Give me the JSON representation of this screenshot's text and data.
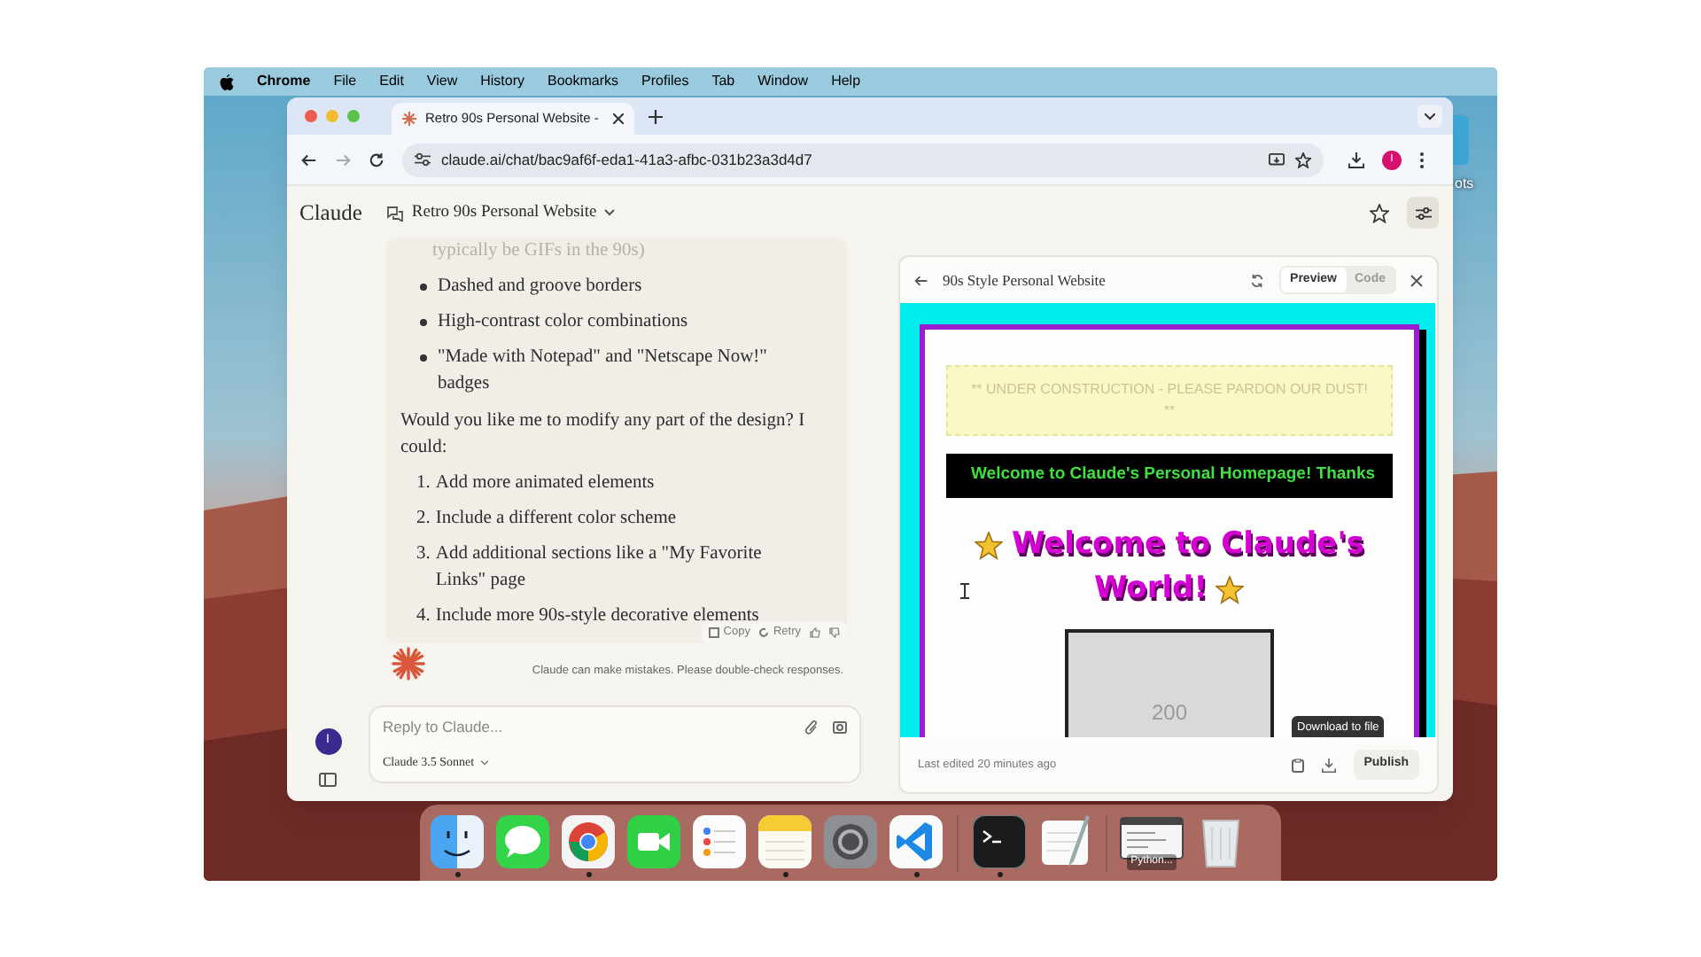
{
  "menu_bar": {
    "app": "Chrome",
    "items": [
      "File",
      "Edit",
      "View",
      "History",
      "Bookmarks",
      "Profiles",
      "Tab",
      "Window",
      "Help"
    ]
  },
  "desktop": {
    "label": "ots"
  },
  "browser": {
    "tabs": [
      {
        "title": "Retro 90s Personal Website -",
        "selected": true
      }
    ],
    "url": "claude.ai/chat/bac9af6f-eda1-41a3-afbc-031b23a3d4d7",
    "profile_initial": "I"
  },
  "claude": {
    "brand": "Claude",
    "chat_title": "Retro 90s Personal Website",
    "message": {
      "faded_line": "typically be GIFs in the 90s)",
      "bullets": [
        "Dashed and groove borders",
        "High-contrast color combinations",
        "\"Made with Notepad\" and \"Netscape Now!\" badges"
      ],
      "question": "Would you like me to modify any part of the design? I could:",
      "options": [
        {
          "number": "1.",
          "text": "Add more animated elements"
        },
        {
          "number": "2.",
          "text": "Include a different color scheme"
        },
        {
          "number": "3.",
          "text": "Add additional sections like a \"My Favorite Links\" page"
        },
        {
          "number": "4.",
          "text": "Include more 90s-style decorative elements"
        }
      ]
    },
    "actions": [
      "Copy",
      "Retry"
    ],
    "disclaimer": "Claude can make mistakes. Please double-check responses.",
    "reply_placeholder": "Reply to Claude...",
    "model": "Claude 3.5 Sonnet",
    "user_initial": "I"
  },
  "artifact": {
    "title": "90s Style Personal Website",
    "view_tabs": [
      {
        "label": "Preview",
        "selected": true
      },
      {
        "label": "Code",
        "selected": false
      }
    ],
    "preview": {
      "notice": "** UNDER CONSTRUCTION - PLEASE PARDON OUR DUST! **",
      "marquee": "Welcome to Claude's Personal Homepage! Thanks",
      "heading_lines": [
        "Welcome to Claude's",
        "World!"
      ],
      "image_label": "200"
    },
    "tooltip": "Download to file",
    "last_edited": "Last edited 20 minutes ago",
    "publish": "Publish"
  },
  "dock": {
    "items": [
      {
        "kind": "finder",
        "running": true
      },
      {
        "kind": "messages"
      },
      {
        "kind": "chrome",
        "running": true
      },
      {
        "kind": "facetime"
      },
      {
        "kind": "reminders"
      },
      {
        "kind": "notes",
        "running": true
      },
      {
        "kind": "settings"
      },
      {
        "kind": "vscode",
        "running": true
      },
      {
        "kind": "separator"
      },
      {
        "kind": "terminal",
        "running": true
      },
      {
        "kind": "textedit"
      },
      {
        "kind": "separator"
      },
      {
        "kind": "window",
        "label": "Python..."
      },
      {
        "kind": "trash"
      }
    ]
  }
}
